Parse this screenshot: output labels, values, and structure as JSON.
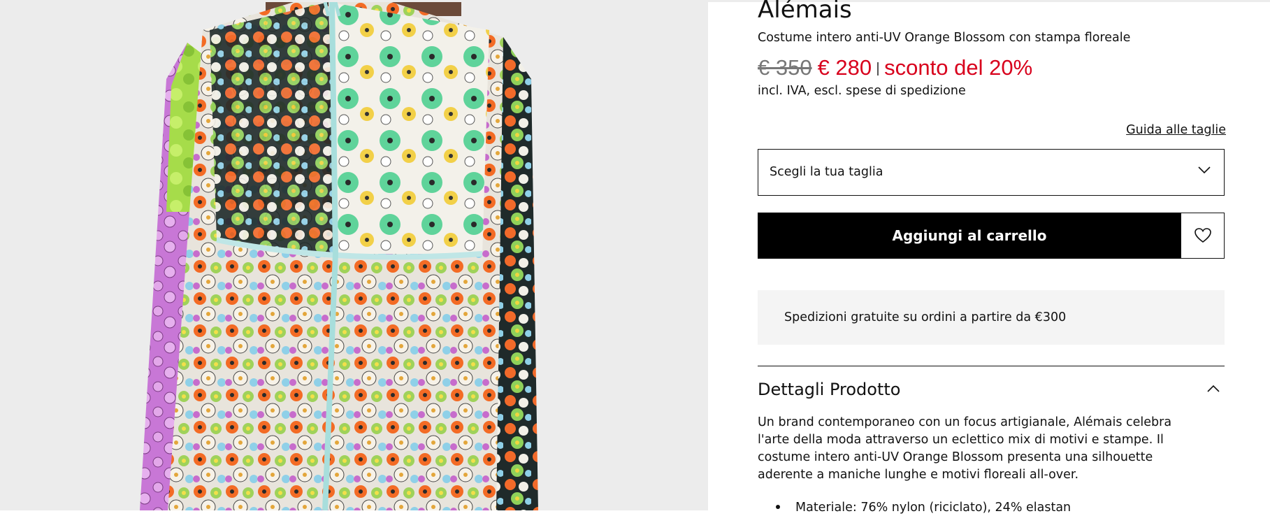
{
  "product": {
    "brand": "Alémais",
    "name": "Costume intero anti-UV Orange Blossom con stampa floreale",
    "price_old": "€ 350",
    "price_new": "€ 280",
    "discount": "sconto del 20%",
    "tax_note": "incl. IVA, escl. spese di spedizione"
  },
  "size": {
    "guide_link": "Guida alle taglie",
    "selector_label": "Scegli la tua taglia"
  },
  "actions": {
    "add_to_cart": "Aggiungi al carrello"
  },
  "shipping": {
    "text": "Spedizioni gratuite su ordini a partire da €300"
  },
  "details": {
    "title": "Dettagli Prodotto",
    "description": "Un brand contemporaneo con un focus artigianale, Alémais celebra l'arte della moda attraverso un eclettico mix di motivi e stampe. Il costume intero anti-UV Orange Blossom presenta una silhouette aderente a maniche lunghe e motivi floreali all-over.",
    "bullets": [
      "Materiale: 76% nylon (riciclato), 24% elastan"
    ]
  },
  "colors": {
    "sale_red": "#d8001c",
    "button_black": "#000000",
    "gallery_bg": "#ececec",
    "shipping_bg": "#f4f4f4"
  },
  "icons": {
    "size_dropdown": "chevron-down-icon",
    "wishlist": "heart-icon",
    "details_toggle": "chevron-up-icon"
  }
}
